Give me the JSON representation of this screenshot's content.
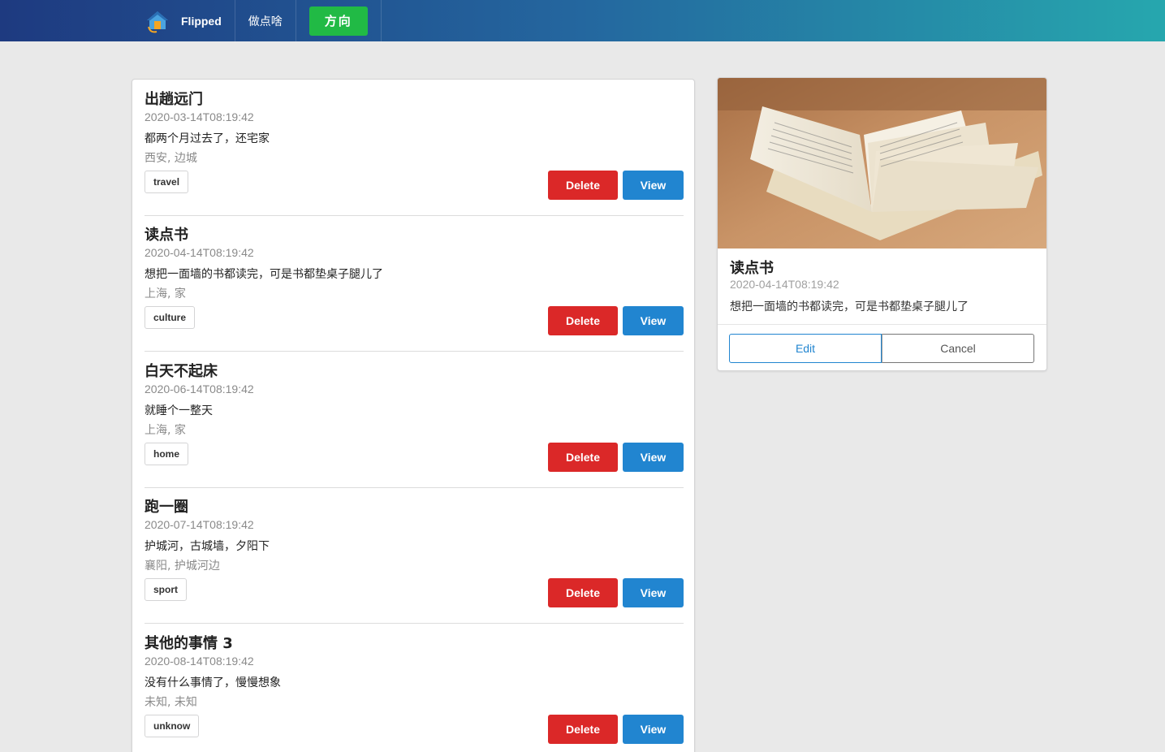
{
  "nav": {
    "brand": "Flipped",
    "link": "做点啥",
    "button": "方向"
  },
  "items": [
    {
      "title": "出趟远门",
      "date": "2020-03-14T08:19:42",
      "desc": "都两个月过去了，还宅家",
      "location": "西安, 边城",
      "tag": "travel",
      "delete": "Delete",
      "view": "View"
    },
    {
      "title": "读点书",
      "date": "2020-04-14T08:19:42",
      "desc": "想把一面墙的书都读完，可是书都垫桌子腿儿了",
      "location": "上海, 家",
      "tag": "culture",
      "delete": "Delete",
      "view": "View"
    },
    {
      "title": "白天不起床",
      "date": "2020-06-14T08:19:42",
      "desc": "就睡个一整天",
      "location": "上海, 家",
      "tag": "home",
      "delete": "Delete",
      "view": "View"
    },
    {
      "title": "跑一圈",
      "date": "2020-07-14T08:19:42",
      "desc": "护城河，古城墙，夕阳下",
      "location": "襄阳, 护城河边",
      "tag": "sport",
      "delete": "Delete",
      "view": "View"
    },
    {
      "title": "其他的事情 3",
      "date": "2020-08-14T08:19:42",
      "desc": "没有什么事情了，慢慢想象",
      "location": "未知, 未知",
      "tag": "unknow",
      "delete": "Delete",
      "view": "View"
    }
  ],
  "detail": {
    "title": "读点书",
    "date": "2020-04-14T08:19:42",
    "desc": "想把一面墙的书都读完，可是书都垫桌子腿儿了",
    "edit": "Edit",
    "cancel": "Cancel"
  },
  "colors": {
    "delete": "#db2828",
    "view": "#2185d0",
    "nav_button": "#21ba45"
  }
}
